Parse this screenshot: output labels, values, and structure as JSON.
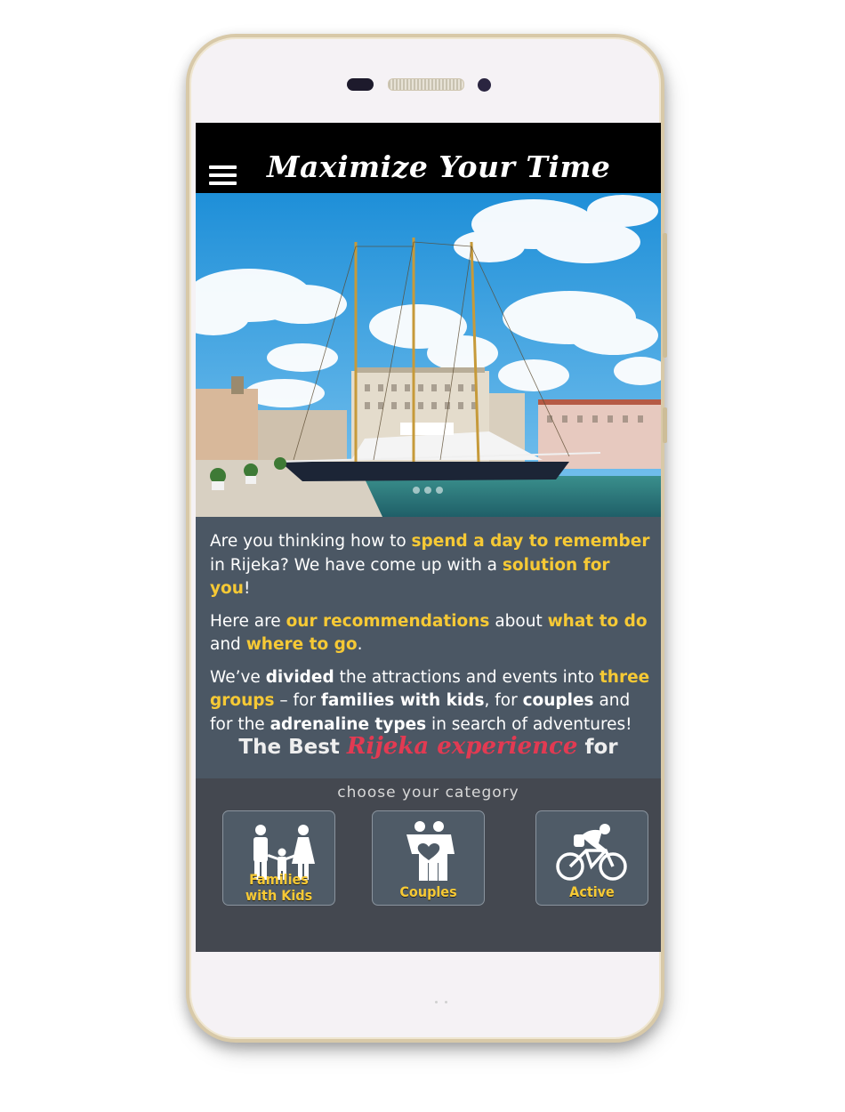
{
  "app": {
    "title": "Maximize Your Time",
    "menu_icon": "hamburger-menu-icon"
  },
  "hero": {
    "image_subject": "tall ship moored at the Rijeka waterfront under a blue sky",
    "slides": 3,
    "active_slide": 1
  },
  "intro": {
    "p1": [
      "Are you thinking how to ",
      "spend a day to remember",
      " in Rijeka? We have come up with a ",
      "solution for you",
      "!"
    ],
    "p2": [
      "Here are ",
      "our recommendations",
      " about ",
      "what to do",
      " and ",
      "where to go",
      "."
    ],
    "p3": [
      "We’ve ",
      "divided",
      " the attractions and events into ",
      "three groups",
      " – for ",
      "families with kids",
      ", for ",
      "couples",
      " and for the ",
      "adrenaline types",
      " in search of adventures!"
    ]
  },
  "tagline": {
    "prefix": "The Best",
    "script": "Rijeka experience",
    "suffix": "for"
  },
  "categories": {
    "heading": "choose your category",
    "items": [
      {
        "label_line1": "Families",
        "label_line2": "with Kids",
        "icon": "family-icon"
      },
      {
        "label": "Couples",
        "icon": "couple-heart-icon"
      },
      {
        "label": "Active",
        "icon": "cyclist-icon"
      }
    ]
  },
  "colors": {
    "accent": "#f6c935",
    "script": "#e23a52",
    "panel": "#4b5764",
    "category_bg": "#444850",
    "header_bg": "#000000"
  }
}
